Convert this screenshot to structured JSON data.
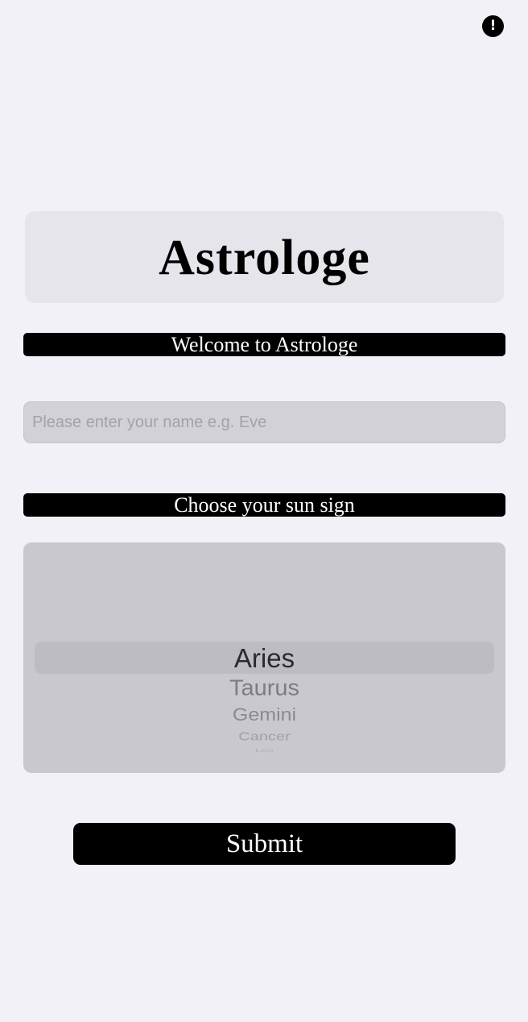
{
  "header": {
    "info_symbol": "!",
    "info_icon": "exclamation-circle-icon"
  },
  "app": {
    "title": "Astrologe",
    "welcome_text": "Welcome to Astrologe"
  },
  "name_field": {
    "value": "",
    "placeholder": "Please enter your name e.g. Eve"
  },
  "sun_sign": {
    "label": "Choose your sun sign",
    "selected": "Aries",
    "visible_options": [
      "Aries",
      "Taurus",
      "Gemini",
      "Cancer",
      "Leo"
    ]
  },
  "submit": {
    "label": "Submit"
  },
  "colors": {
    "background": "#f2f1f7",
    "banner": "#000000",
    "banner_text": "#ffffff",
    "card": "#e6e5eb",
    "input": "#d2d1d7",
    "picker": "#c9c8ce"
  }
}
